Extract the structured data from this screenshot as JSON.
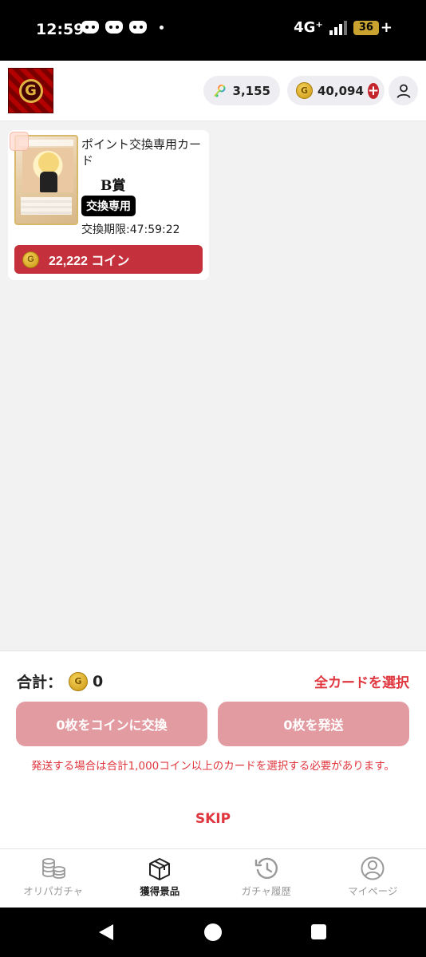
{
  "status_bar": {
    "time": "12:59",
    "network": "4G⁺",
    "battery": "36",
    "charging": "+"
  },
  "header": {
    "keys_count": "3,155",
    "coins_count": "40,094",
    "coin_glyph": "G",
    "add_glyph": "+"
  },
  "card": {
    "title": "ポイント交換専用カード",
    "grade": "B賞",
    "badge": "交換専用",
    "deadline": "交換期限:47:59:22",
    "coin_button_label": "22,222 コイン"
  },
  "panel": {
    "total_label": "合計：",
    "total_value": "0",
    "select_all_label": "全カードを選択",
    "exchange_label": "0枚をコインに交換",
    "ship_label": "0枚を発送",
    "notice": "発送する場合は合計1,000コイン以上のカードを選択する必要があります。",
    "skip_label": "SKIP"
  },
  "tabs": [
    {
      "label": "オリパガチャ",
      "icon": "coins-stack-icon",
      "active": false
    },
    {
      "label": "獲得景品",
      "icon": "box-icon",
      "active": true
    },
    {
      "label": "ガチャ履歴",
      "icon": "history-icon",
      "active": false
    },
    {
      "label": "マイページ",
      "icon": "user-circle-icon",
      "active": false
    }
  ],
  "colors": {
    "accent_red": "#e0373f",
    "coin_button": "#c4303b",
    "disabled_button": "#e29ba1"
  }
}
